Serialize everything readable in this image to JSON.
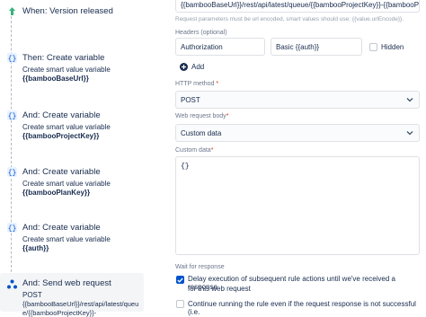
{
  "rule_chain": {
    "trigger": {
      "title": "When: Version released"
    },
    "nodes": [
      {
        "title": "Then: Create variable",
        "subtitle": "Create smart value variable",
        "value": "{{bambooBaseUrl}}"
      },
      {
        "title": "And: Create variable",
        "subtitle": "Create smart value variable",
        "value": "{{bambooProjectKey}}"
      },
      {
        "title": "And: Create variable",
        "subtitle": "Create smart value variable",
        "value": "{{bambooPlanKey}}"
      },
      {
        "title": "And: Create variable",
        "subtitle": "Create smart value variable",
        "value": "{{auth}}"
      }
    ],
    "selected": {
      "title": "And: Send web request",
      "line1": "POST",
      "line2": "{{bambooBaseUrl}}/rest/api/latest/queu",
      "line3": "e/{{bambooProjectKey}}-"
    }
  },
  "config": {
    "url_value": "{{bambooBaseUrl}}/rest/api/latest/queue/{{bambooProjectKey}}-{{bambooPlan",
    "url_help": "Request parameters must be url encoded, smart values should use: {{value.urlEncode}}.",
    "headers_label": "Headers (optional)",
    "header_name": "Authorization",
    "header_value": "Basic {{auth}}",
    "hidden_label": "Hidden",
    "add_label": "Add",
    "method_label": "HTTP method",
    "method_value": "POST",
    "body_label": "Web request body",
    "body_value": "Custom data",
    "custom_label": "Custom data",
    "custom_value": "{}",
    "wait_label": "Wait for response",
    "delay_text_1": "Delay execution of subsequent rule actions until we've received a response",
    "delay_text_2": "for this web request",
    "continue_text": "Continue running the rule even if the request response is not successful (i.e.",
    "required_mark": "*",
    "colors": {
      "accent": "#0052cc",
      "green": "#36b37e",
      "text": "#172b4d",
      "muted": "#6b778c"
    }
  }
}
